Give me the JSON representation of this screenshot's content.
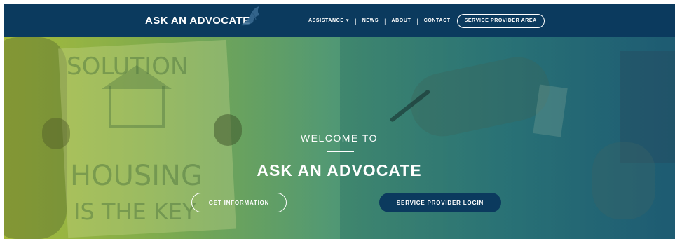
{
  "header": {
    "logo_text": "ASK AN ADVOCATE",
    "logo_icon": "bird-icon"
  },
  "nav": {
    "items": [
      {
        "label": "ASSISTANCE",
        "has_dropdown": true
      },
      {
        "label": "NEWS"
      },
      {
        "label": "ABOUT"
      },
      {
        "label": "CONTACT"
      }
    ],
    "separator": "|",
    "dropdown_glyph": "♥",
    "cta_label": "SERVICE PROVIDER AREA"
  },
  "hero": {
    "welcome": "WELCOME TO",
    "headline": "ASK AN ADVOCATE",
    "sign_words": [
      "SOLUTION",
      "HOUSING",
      "IS THE KEY"
    ]
  },
  "actions": {
    "get_information": "GET INFORMATION",
    "service_provider_login": "SERVICE PROVIDER LOGIN"
  },
  "colors": {
    "navy": "#0b3a5e",
    "green": "#9ab63a",
    "teal": "#2f7d7f"
  }
}
